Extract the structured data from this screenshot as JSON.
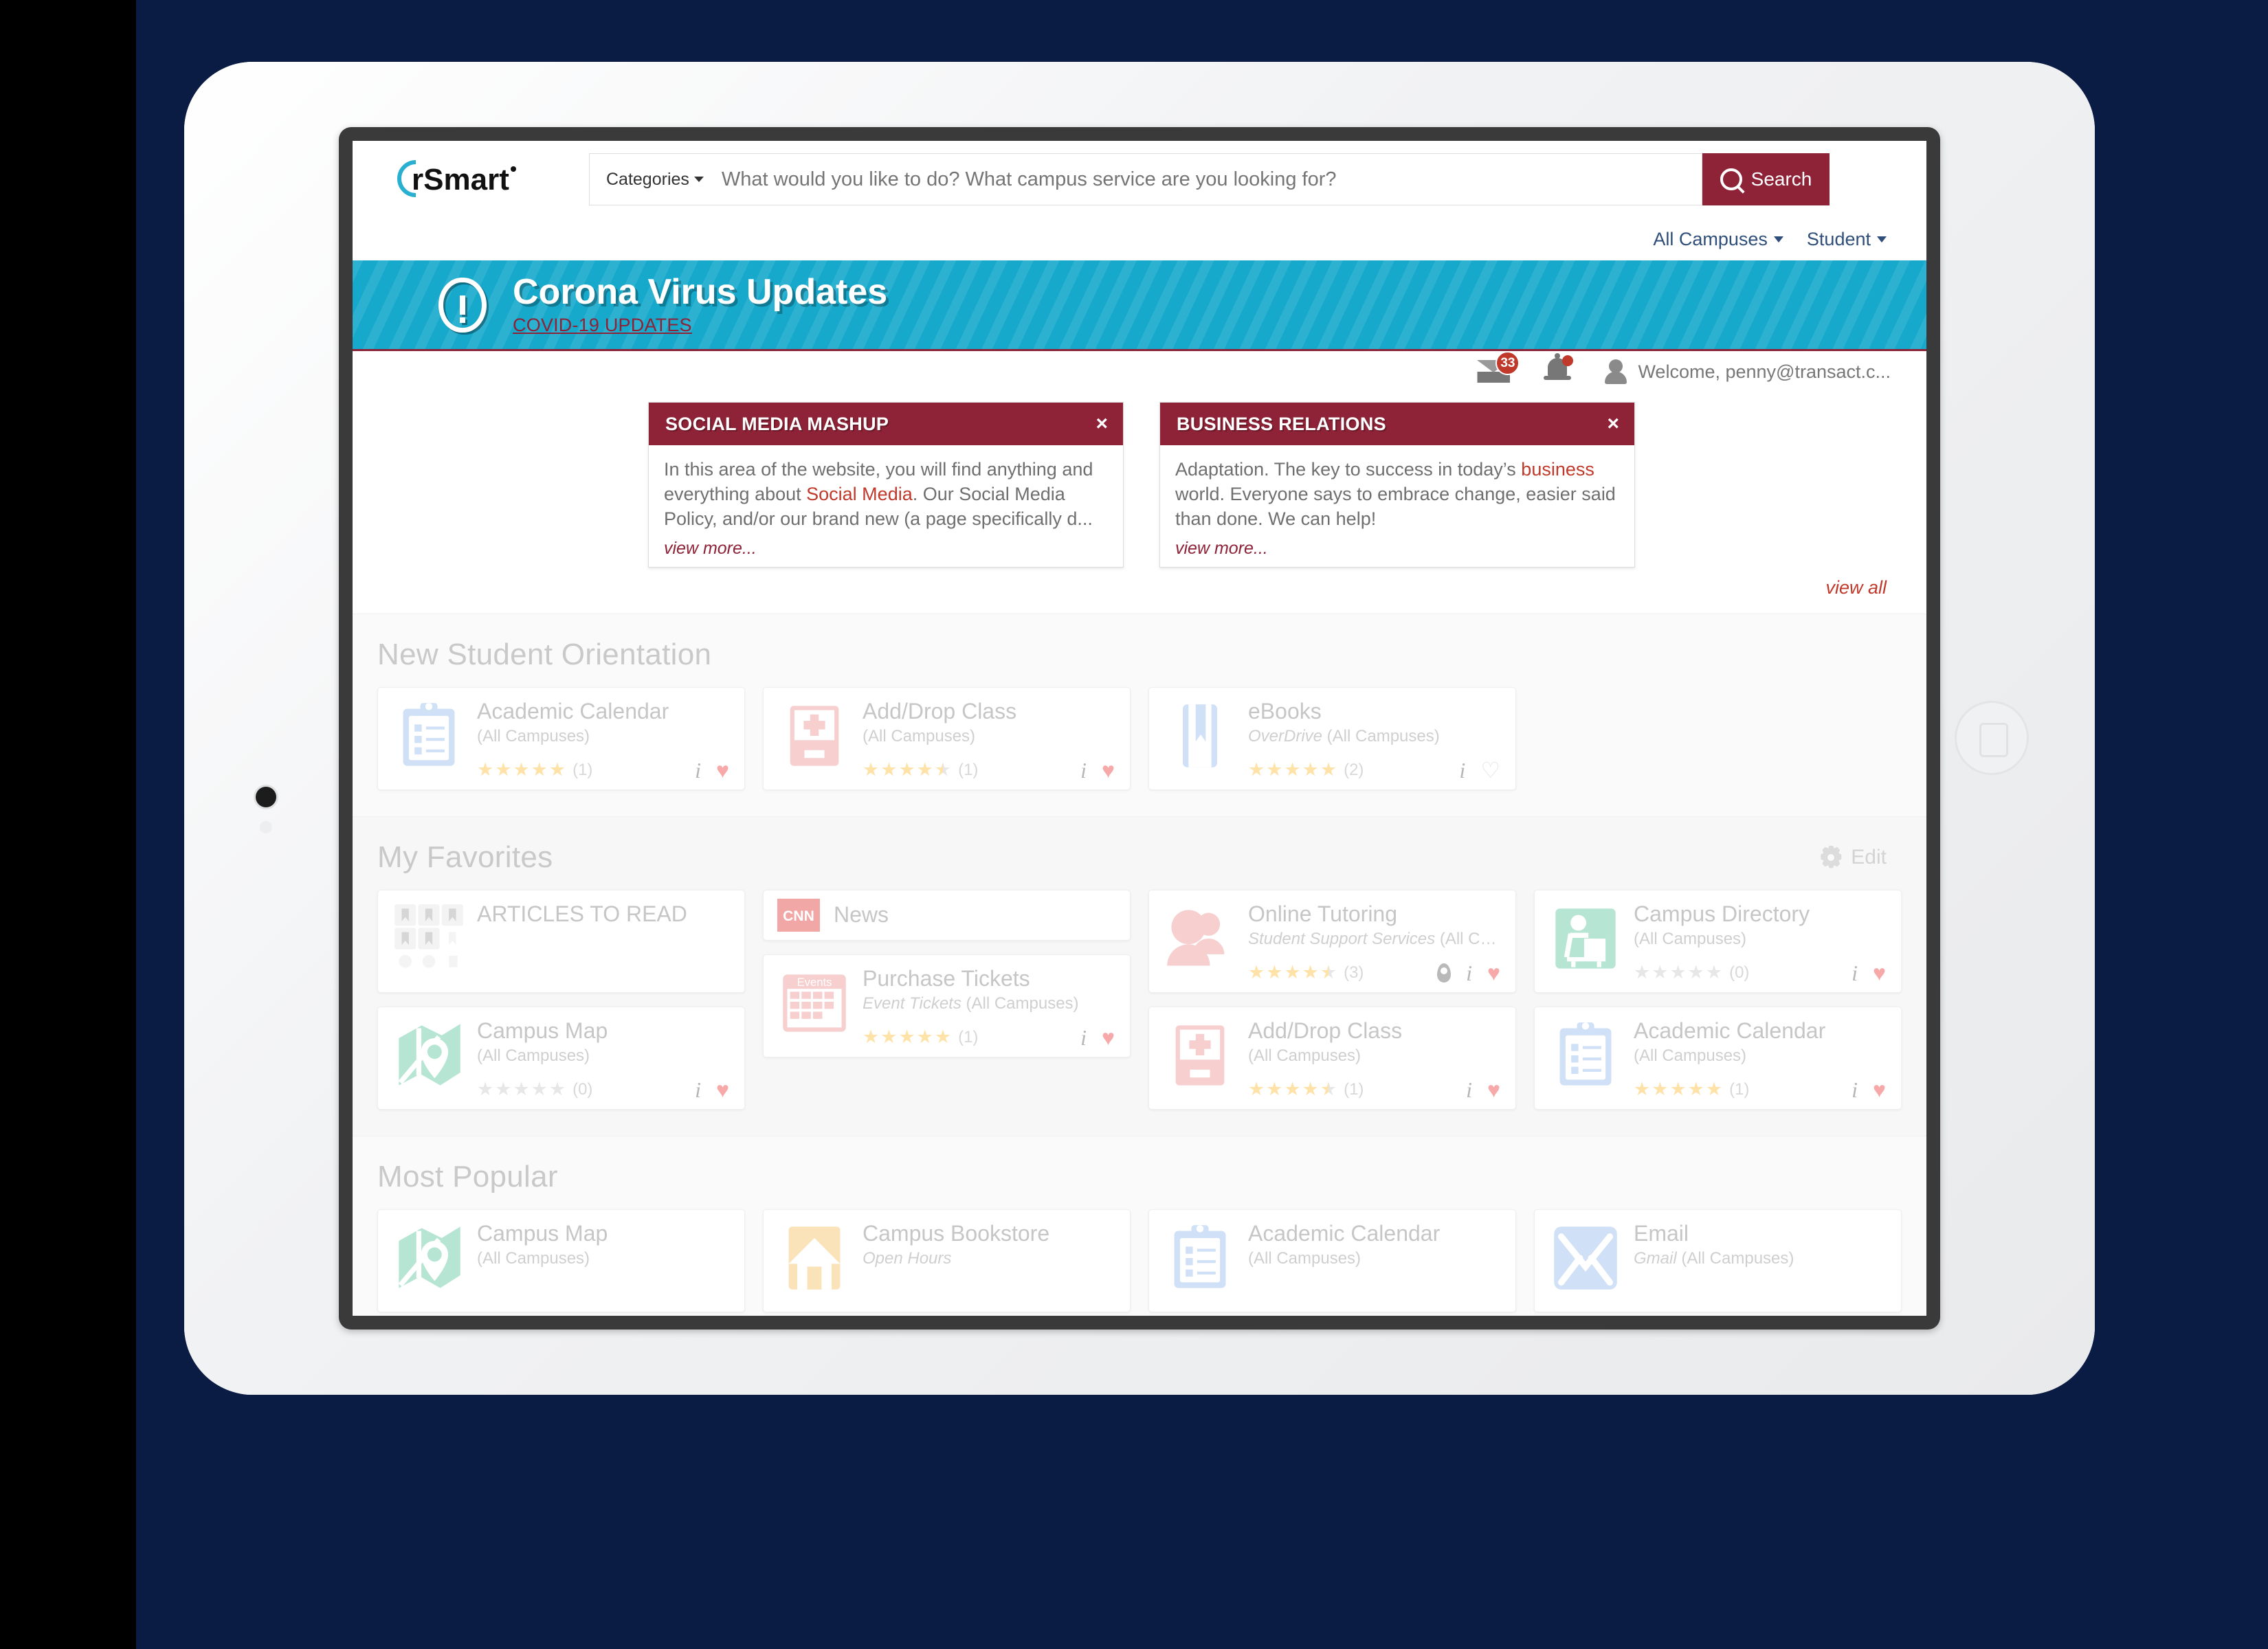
{
  "header": {
    "logo_text": "rSmart",
    "categories_label": "Categories",
    "search_placeholder": "What would you like to do? What campus service are you looking for?",
    "search_value": "",
    "search_button": "Search",
    "campus_selector": "All Campuses",
    "role_selector": "Student"
  },
  "banner": {
    "title": "Corona Virus Updates",
    "link": "COVID-19 UPDATES"
  },
  "userbar": {
    "mail_count": "33",
    "welcome": "Welcome, penny@transact.c..."
  },
  "announcements": {
    "view_all": "view all",
    "cards": [
      {
        "title": "SOCIAL MEDIA MASHUP",
        "close": "×",
        "body_pre": "In this area of the website, you will find anything and everything about ",
        "body_link": "Social Media",
        "body_post": ". Our Social Media Policy, and/or our brand new (a page specifically d...",
        "view_more": "view more..."
      },
      {
        "title": "BUSINESS RELATIONS",
        "close": "×",
        "body_pre": "Adaptation. The key to success in today’s ",
        "body_link": "business",
        "body_post": " world. Everyone says to embrace change, easier said than done. We can help!",
        "view_more": "view more..."
      }
    ]
  },
  "sections": {
    "orientation": {
      "title": "New Student Orientation",
      "tiles": [
        {
          "name": "Academic Calendar",
          "sub": "(All Campuses)",
          "sub_italic": "",
          "rating": 5,
          "count": "(1)",
          "fav": true,
          "icon": "clipboard-icon",
          "color": "#cfe0f7"
        },
        {
          "name": "Add/Drop Class",
          "sub": "(All Campuses)",
          "sub_italic": "",
          "rating": 4.5,
          "count": "(1)",
          "fav": true,
          "icon": "add-drop-icon",
          "color": "#f7cfcf"
        },
        {
          "name": "eBooks",
          "sub": "(All Campuses)",
          "sub_italic": "OverDrive",
          "rating": 5,
          "count": "(2)",
          "fav": false,
          "icon": "book-icon",
          "color": "#cfe0f7"
        }
      ]
    },
    "favorites": {
      "title": "My Favorites",
      "edit_label": "Edit",
      "columns": [
        [
          {
            "name": "ARTICLES TO READ",
            "sub": "",
            "sub_italic": "",
            "rating": null,
            "count": "",
            "fav": null,
            "icon": "articles-grid-icon",
            "color": "#eeeeee",
            "short": false,
            "tall": true
          },
          {
            "name": "Campus Map",
            "sub": "(All Campuses)",
            "sub_italic": "",
            "rating": 0,
            "count": "(0)",
            "fav": true,
            "icon": "map-icon",
            "color": "#b7e5d4",
            "short": false
          }
        ],
        [
          {
            "name": "News",
            "sub": "",
            "sub_italic": "",
            "rating": null,
            "count": "",
            "fav": null,
            "icon": "cnn-icon",
            "color": "#f2a7a7",
            "short": true
          },
          {
            "name": "Purchase Tickets",
            "sub": "(All Campuses)",
            "sub_italic": "Event Tickets",
            "rating": 5,
            "count": "(1)",
            "fav": true,
            "icon": "events-calendar-icon",
            "color": "#f7cfcf",
            "short": false
          }
        ],
        [
          {
            "name": "Online Tutoring",
            "sub": "(All Campu...",
            "sub_italic": "Student Support Services",
            "rating": 4.5,
            "count": "(3)",
            "fav": true,
            "pin": true,
            "icon": "people-icon",
            "color": "#f7cfcf",
            "short": false
          },
          {
            "name": "Add/Drop Class",
            "sub": "(All Campuses)",
            "sub_italic": "",
            "rating": 4.5,
            "count": "(1)",
            "fav": true,
            "icon": "add-drop-icon",
            "color": "#f7cfcf",
            "short": false
          }
        ],
        [
          {
            "name": "Campus Directory",
            "sub": "(All Campuses)",
            "sub_italic": "",
            "rating": 0,
            "count": "(0)",
            "fav": true,
            "icon": "directory-icon",
            "color": "#b7e5d4",
            "short": false
          },
          {
            "name": "Academic Calendar",
            "sub": "(All Campuses)",
            "sub_italic": "",
            "rating": 5,
            "count": "(1)",
            "fav": true,
            "icon": "clipboard-icon",
            "color": "#cfe0f7",
            "short": false
          }
        ]
      ]
    },
    "popular": {
      "title": "Most Popular",
      "tiles": [
        {
          "name": "Campus Map",
          "sub": "(All Campuses)",
          "sub_italic": "",
          "icon": "map-icon",
          "color": "#b7e5d4"
        },
        {
          "name": "Campus Bookstore",
          "sub": "",
          "sub_italic": "Open Hours",
          "icon": "house-icon",
          "color": "#fae3b8"
        },
        {
          "name": "Academic Calendar",
          "sub": "(All Campuses)",
          "sub_italic": "",
          "icon": "clipboard-icon",
          "color": "#cfe0f7"
        },
        {
          "name": "Email",
          "sub": "(All Campuses)",
          "sub_italic": "Gmail",
          "icon": "mail-icon",
          "color": "#cfe0f7"
        }
      ]
    }
  },
  "colors": {
    "brand_red": "#8e2237",
    "banner_cyan": "#17a9cc",
    "accent_link": "#c0392b",
    "nav_blue": "#2f4f7a"
  }
}
